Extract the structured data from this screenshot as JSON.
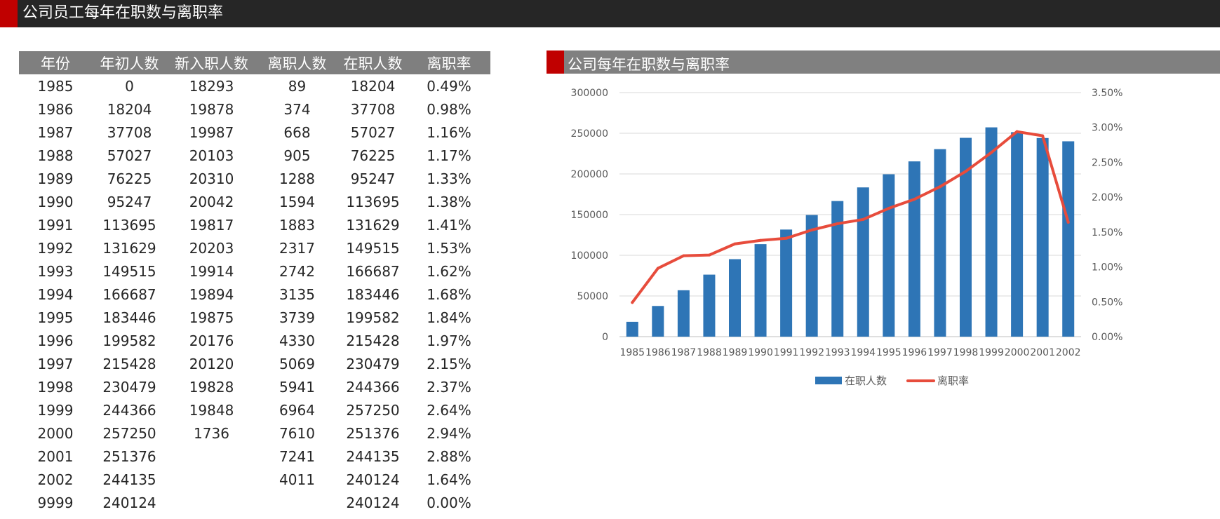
{
  "page_title": "公司员工每年在职数与离职率",
  "table": {
    "headers": [
      "年份",
      "年初人数",
      "新入职人数",
      "离职人数",
      "在职人数",
      "离职率"
    ],
    "rows": [
      [
        "1985",
        "0",
        "18293",
        "89",
        "18204",
        "0.49%"
      ],
      [
        "1986",
        "18204",
        "19878",
        "374",
        "37708",
        "0.98%"
      ],
      [
        "1987",
        "37708",
        "19987",
        "668",
        "57027",
        "1.16%"
      ],
      [
        "1988",
        "57027",
        "20103",
        "905",
        "76225",
        "1.17%"
      ],
      [
        "1989",
        "76225",
        "20310",
        "1288",
        "95247",
        "1.33%"
      ],
      [
        "1990",
        "95247",
        "20042",
        "1594",
        "113695",
        "1.38%"
      ],
      [
        "1991",
        "113695",
        "19817",
        "1883",
        "131629",
        "1.41%"
      ],
      [
        "1992",
        "131629",
        "20203",
        "2317",
        "149515",
        "1.53%"
      ],
      [
        "1993",
        "149515",
        "19914",
        "2742",
        "166687",
        "1.62%"
      ],
      [
        "1994",
        "166687",
        "19894",
        "3135",
        "183446",
        "1.68%"
      ],
      [
        "1995",
        "183446",
        "19875",
        "3739",
        "199582",
        "1.84%"
      ],
      [
        "1996",
        "199582",
        "20176",
        "4330",
        "215428",
        "1.97%"
      ],
      [
        "1997",
        "215428",
        "20120",
        "5069",
        "230479",
        "2.15%"
      ],
      [
        "1998",
        "230479",
        "19828",
        "5941",
        "244366",
        "2.37%"
      ],
      [
        "1999",
        "244366",
        "19848",
        "6964",
        "257250",
        "2.64%"
      ],
      [
        "2000",
        "257250",
        "1736",
        "7610",
        "251376",
        "2.94%"
      ],
      [
        "2001",
        "251376",
        "",
        "7241",
        "244135",
        "2.88%"
      ],
      [
        "2002",
        "244135",
        "",
        "4011",
        "240124",
        "1.64%"
      ],
      [
        "9999",
        "240124",
        "",
        "",
        "240124",
        "0.00%"
      ]
    ]
  },
  "chart_panel": {
    "title": "公司每年在职数与离职率"
  },
  "chart_data": {
    "type": "bar",
    "categories": [
      "1985",
      "1986",
      "1987",
      "1988",
      "1989",
      "1990",
      "1991",
      "1992",
      "1993",
      "1994",
      "1995",
      "1996",
      "1997",
      "1998",
      "1999",
      "2000",
      "2001",
      "2002"
    ],
    "series": [
      {
        "name": "在职人数",
        "type": "bar",
        "axis": "left",
        "color": "#2e75b6",
        "values": [
          18204,
          37708,
          57027,
          76225,
          95247,
          113695,
          131629,
          149515,
          166687,
          183446,
          199582,
          215428,
          230479,
          244366,
          257250,
          251376,
          244135,
          240124
        ]
      },
      {
        "name": "离职率",
        "type": "line",
        "axis": "right",
        "color": "#e74c3c",
        "values": [
          0.0049,
          0.0098,
          0.0116,
          0.0117,
          0.0133,
          0.0138,
          0.0141,
          0.0153,
          0.0162,
          0.0168,
          0.0184,
          0.0197,
          0.0215,
          0.0237,
          0.0264,
          0.0294,
          0.0288,
          0.0164
        ]
      }
    ],
    "y_left": {
      "min": 0,
      "max": 300000,
      "step": 50000,
      "ticks": [
        "0",
        "50000",
        "100000",
        "150000",
        "200000",
        "250000",
        "300000"
      ]
    },
    "y_right": {
      "min": 0,
      "max": 0.035,
      "step": 0.005,
      "ticks": [
        "0.00%",
        "0.50%",
        "1.00%",
        "1.50%",
        "2.00%",
        "2.50%",
        "3.00%",
        "3.50%"
      ]
    },
    "grid": true,
    "legend": "bottom"
  }
}
